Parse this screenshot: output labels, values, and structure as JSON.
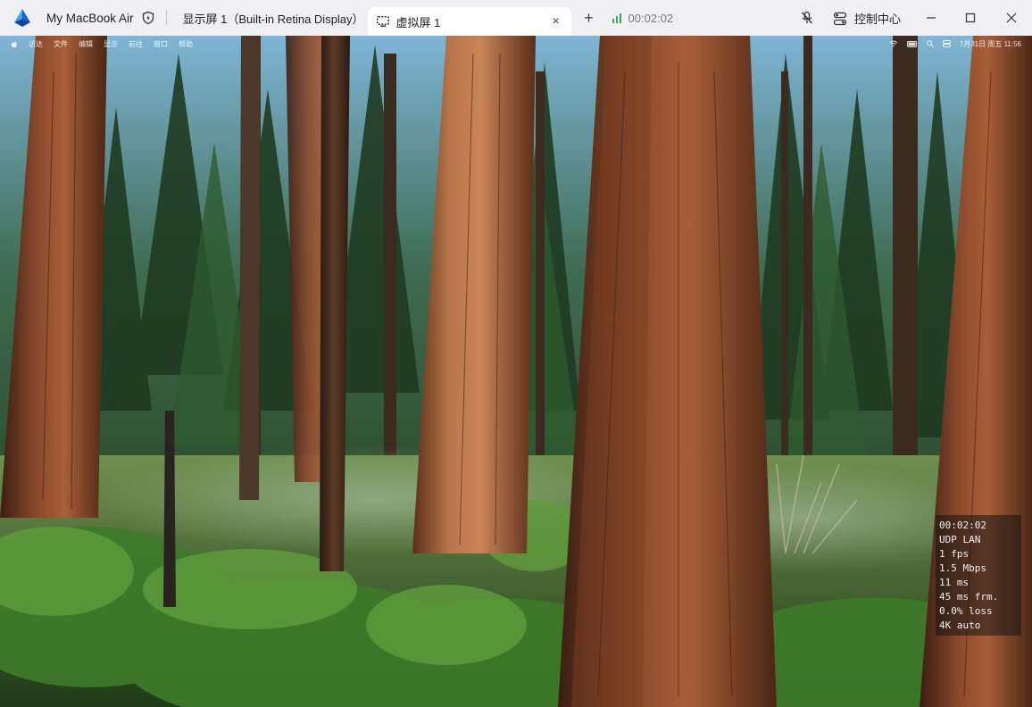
{
  "topbar": {
    "device_name": "My MacBook Air",
    "tabs": [
      {
        "label": "显示屏 1（Built-in Retina Display）",
        "active": false
      },
      {
        "label": "虚拟屏 1",
        "active": true
      }
    ],
    "close_tab_symbol": "×",
    "add_tab_symbol": "+",
    "session_timer": "00:02:02",
    "control_center_label": "控制中心"
  },
  "remote": {
    "menubar": {
      "items": [
        "访达",
        "文件",
        "编辑",
        "显示",
        "前往",
        "窗口",
        "帮助"
      ],
      "clock": "7月31日 周五  11:56"
    },
    "stats": {
      "time": "00:02:02",
      "protocol": "UDP LAN",
      "fps": "1 fps",
      "bitrate": "1.5 Mbps",
      "latency": "11 ms",
      "frame_latency": "45 ms frm.",
      "loss": "0.0% loss",
      "quality": "4K auto"
    }
  },
  "colors": {
    "topbar_bg": "#f0f0f2",
    "active_tab_bg": "#ffffff",
    "signal_green": "#2bb24c",
    "logo_blue": "#1e88ff"
  }
}
